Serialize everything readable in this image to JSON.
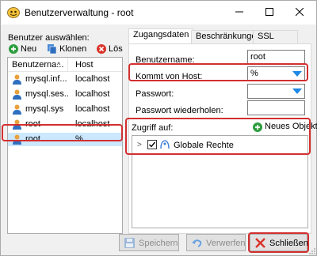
{
  "window": {
    "title": "Benutzerverwaltung - root"
  },
  "left": {
    "label": "Benutzer auswählen:",
    "toolbar": {
      "new": "Neu",
      "clone": "Klonen",
      "delete": "Lös"
    },
    "columns": {
      "user": "Benutzerna...",
      "host": "Host"
    },
    "users": [
      {
        "name": "mysql.inf...",
        "host": "localhost"
      },
      {
        "name": "mysql.ses...",
        "host": "localhost"
      },
      {
        "name": "mysql.sys",
        "host": "localhost"
      },
      {
        "name": "root",
        "host": "localhost"
      },
      {
        "name": "root",
        "host": "%"
      }
    ]
  },
  "tabs": [
    "Zugangsdaten",
    "Beschränkungen",
    "SSL Optionen"
  ],
  "form": {
    "username_label": "Benutzername:",
    "username_value": "root",
    "host_label": "Kommt von Host:",
    "host_value": "%",
    "password_label": "Passwort:",
    "password_repeat_label": "Passwort wiederholen:"
  },
  "access": {
    "label": "Zugriff auf:",
    "new_object": "Neues Objekt",
    "tree_item": "Globale Rechte"
  },
  "buttons": {
    "save": "Speichern",
    "discard": "Verwerfen",
    "close": "Schließen"
  },
  "colors": {
    "highlight": "#d32f2f",
    "selected_row": "#cce8ff",
    "accent": "#1e88e5"
  }
}
